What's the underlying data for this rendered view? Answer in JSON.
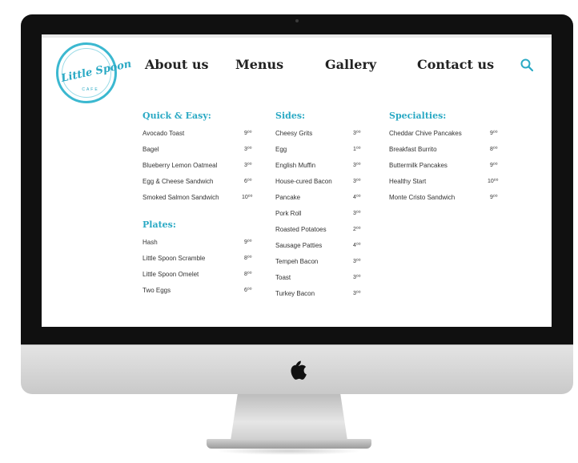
{
  "site": {
    "logo": {
      "name": "Little Spoon",
      "sub": "CAFE"
    },
    "nav": [
      "About us",
      "Menus",
      "Gallery",
      "Contact us"
    ],
    "accent_color": "#2aa9c4",
    "icons": {
      "search": "search-icon",
      "apple": "apple-logo-icon"
    }
  },
  "menu": {
    "quick_easy": {
      "title": "Quick & Easy:",
      "items": [
        {
          "name": "Avocado Toast",
          "price": "9⁰⁰"
        },
        {
          "name": "Bagel",
          "price": "3⁰⁰"
        },
        {
          "name": "Blueberry Lemon Oatmeal",
          "price": "3⁰⁰"
        },
        {
          "name": "Egg & Cheese Sandwich",
          "price": "6⁰⁰"
        },
        {
          "name": "Smoked Salmon Sandwich",
          "price": "10⁰⁰"
        }
      ]
    },
    "plates": {
      "title": "Plates:",
      "items": [
        {
          "name": "Hash",
          "price": "9⁰⁰"
        },
        {
          "name": "Little Spoon Scramble",
          "price": "8⁰⁰"
        },
        {
          "name": "Little Spoon Omelet",
          "price": "8⁰⁰"
        },
        {
          "name": "Two Eggs",
          "price": "6⁰⁰"
        }
      ]
    },
    "sides": {
      "title": "Sides:",
      "items": [
        {
          "name": "Cheesy Grits",
          "price": "3⁰⁰"
        },
        {
          "name": "Egg",
          "price": "1⁰⁰"
        },
        {
          "name": "English Muffin",
          "price": "3⁰⁰"
        },
        {
          "name": "House-cured Bacon",
          "price": "3⁰⁰"
        },
        {
          "name": "Pancake",
          "price": "4⁰⁰"
        },
        {
          "name": "Pork Roll",
          "price": "3⁰⁰"
        },
        {
          "name": "Roasted Potatoes",
          "price": "2⁰⁰"
        },
        {
          "name": "Sausage Patties",
          "price": "4⁰⁰"
        },
        {
          "name": "Tempeh Bacon",
          "price": "3⁰⁰"
        },
        {
          "name": "Toast",
          "price": "3⁰⁰"
        },
        {
          "name": "Turkey Bacon",
          "price": "3⁰⁰"
        }
      ]
    },
    "specialties": {
      "title": "Specialties:",
      "items": [
        {
          "name": "Cheddar Chive Pancakes",
          "price": "9⁰⁰"
        },
        {
          "name": "Breakfast Burrito",
          "price": "8⁰⁰"
        },
        {
          "name": "Buttermilk Pancakes",
          "price": "9⁰⁰"
        },
        {
          "name": "Healthy Start",
          "price": "10⁰⁰"
        },
        {
          "name": "Monte Cristo Sandwich",
          "price": "9⁰⁰"
        }
      ]
    }
  }
}
